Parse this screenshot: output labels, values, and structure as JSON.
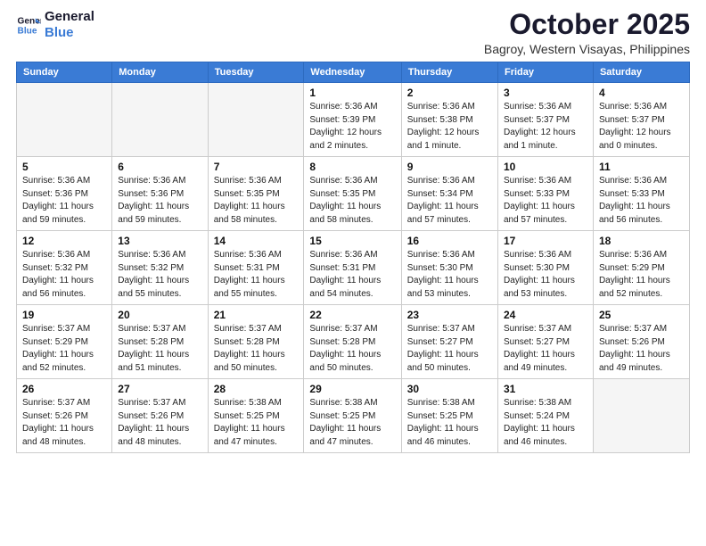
{
  "header": {
    "logo_line1": "General",
    "logo_line2": "Blue",
    "month": "October 2025",
    "location": "Bagroy, Western Visayas, Philippines"
  },
  "weekdays": [
    "Sunday",
    "Monday",
    "Tuesday",
    "Wednesday",
    "Thursday",
    "Friday",
    "Saturday"
  ],
  "weeks": [
    [
      {
        "day": "",
        "info": ""
      },
      {
        "day": "",
        "info": ""
      },
      {
        "day": "",
        "info": ""
      },
      {
        "day": "1",
        "info": "Sunrise: 5:36 AM\nSunset: 5:39 PM\nDaylight: 12 hours\nand 2 minutes."
      },
      {
        "day": "2",
        "info": "Sunrise: 5:36 AM\nSunset: 5:38 PM\nDaylight: 12 hours\nand 1 minute."
      },
      {
        "day": "3",
        "info": "Sunrise: 5:36 AM\nSunset: 5:37 PM\nDaylight: 12 hours\nand 1 minute."
      },
      {
        "day": "4",
        "info": "Sunrise: 5:36 AM\nSunset: 5:37 PM\nDaylight: 12 hours\nand 0 minutes."
      }
    ],
    [
      {
        "day": "5",
        "info": "Sunrise: 5:36 AM\nSunset: 5:36 PM\nDaylight: 11 hours\nand 59 minutes."
      },
      {
        "day": "6",
        "info": "Sunrise: 5:36 AM\nSunset: 5:36 PM\nDaylight: 11 hours\nand 59 minutes."
      },
      {
        "day": "7",
        "info": "Sunrise: 5:36 AM\nSunset: 5:35 PM\nDaylight: 11 hours\nand 58 minutes."
      },
      {
        "day": "8",
        "info": "Sunrise: 5:36 AM\nSunset: 5:35 PM\nDaylight: 11 hours\nand 58 minutes."
      },
      {
        "day": "9",
        "info": "Sunrise: 5:36 AM\nSunset: 5:34 PM\nDaylight: 11 hours\nand 57 minutes."
      },
      {
        "day": "10",
        "info": "Sunrise: 5:36 AM\nSunset: 5:33 PM\nDaylight: 11 hours\nand 57 minutes."
      },
      {
        "day": "11",
        "info": "Sunrise: 5:36 AM\nSunset: 5:33 PM\nDaylight: 11 hours\nand 56 minutes."
      }
    ],
    [
      {
        "day": "12",
        "info": "Sunrise: 5:36 AM\nSunset: 5:32 PM\nDaylight: 11 hours\nand 56 minutes."
      },
      {
        "day": "13",
        "info": "Sunrise: 5:36 AM\nSunset: 5:32 PM\nDaylight: 11 hours\nand 55 minutes."
      },
      {
        "day": "14",
        "info": "Sunrise: 5:36 AM\nSunset: 5:31 PM\nDaylight: 11 hours\nand 55 minutes."
      },
      {
        "day": "15",
        "info": "Sunrise: 5:36 AM\nSunset: 5:31 PM\nDaylight: 11 hours\nand 54 minutes."
      },
      {
        "day": "16",
        "info": "Sunrise: 5:36 AM\nSunset: 5:30 PM\nDaylight: 11 hours\nand 53 minutes."
      },
      {
        "day": "17",
        "info": "Sunrise: 5:36 AM\nSunset: 5:30 PM\nDaylight: 11 hours\nand 53 minutes."
      },
      {
        "day": "18",
        "info": "Sunrise: 5:36 AM\nSunset: 5:29 PM\nDaylight: 11 hours\nand 52 minutes."
      }
    ],
    [
      {
        "day": "19",
        "info": "Sunrise: 5:37 AM\nSunset: 5:29 PM\nDaylight: 11 hours\nand 52 minutes."
      },
      {
        "day": "20",
        "info": "Sunrise: 5:37 AM\nSunset: 5:28 PM\nDaylight: 11 hours\nand 51 minutes."
      },
      {
        "day": "21",
        "info": "Sunrise: 5:37 AM\nSunset: 5:28 PM\nDaylight: 11 hours\nand 50 minutes."
      },
      {
        "day": "22",
        "info": "Sunrise: 5:37 AM\nSunset: 5:28 PM\nDaylight: 11 hours\nand 50 minutes."
      },
      {
        "day": "23",
        "info": "Sunrise: 5:37 AM\nSunset: 5:27 PM\nDaylight: 11 hours\nand 50 minutes."
      },
      {
        "day": "24",
        "info": "Sunrise: 5:37 AM\nSunset: 5:27 PM\nDaylight: 11 hours\nand 49 minutes."
      },
      {
        "day": "25",
        "info": "Sunrise: 5:37 AM\nSunset: 5:26 PM\nDaylight: 11 hours\nand 49 minutes."
      }
    ],
    [
      {
        "day": "26",
        "info": "Sunrise: 5:37 AM\nSunset: 5:26 PM\nDaylight: 11 hours\nand 48 minutes."
      },
      {
        "day": "27",
        "info": "Sunrise: 5:37 AM\nSunset: 5:26 PM\nDaylight: 11 hours\nand 48 minutes."
      },
      {
        "day": "28",
        "info": "Sunrise: 5:38 AM\nSunset: 5:25 PM\nDaylight: 11 hours\nand 47 minutes."
      },
      {
        "day": "29",
        "info": "Sunrise: 5:38 AM\nSunset: 5:25 PM\nDaylight: 11 hours\nand 47 minutes."
      },
      {
        "day": "30",
        "info": "Sunrise: 5:38 AM\nSunset: 5:25 PM\nDaylight: 11 hours\nand 46 minutes."
      },
      {
        "day": "31",
        "info": "Sunrise: 5:38 AM\nSunset: 5:24 PM\nDaylight: 11 hours\nand 46 minutes."
      },
      {
        "day": "",
        "info": ""
      }
    ]
  ]
}
